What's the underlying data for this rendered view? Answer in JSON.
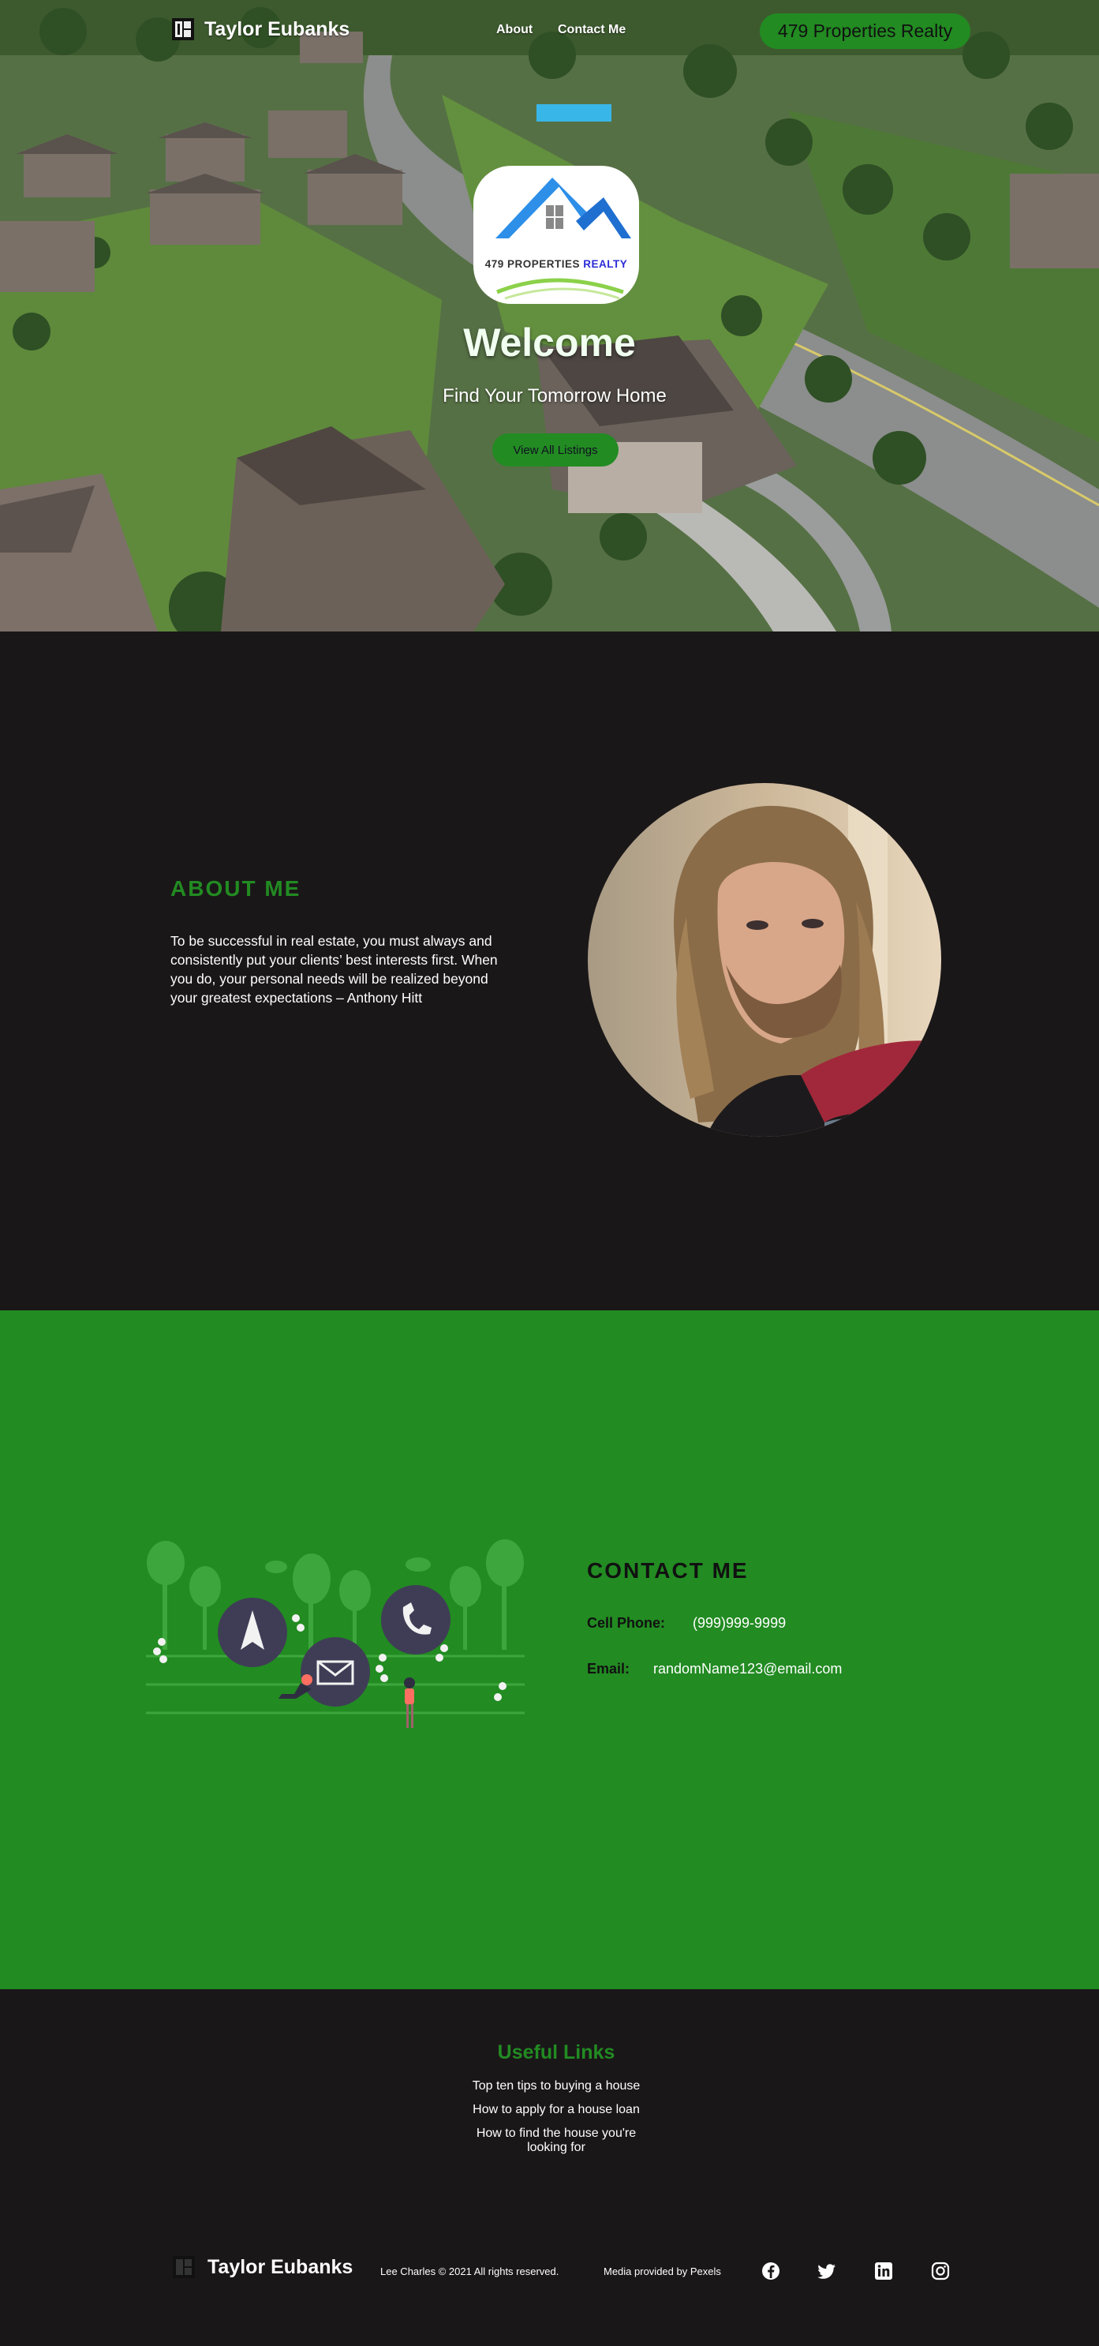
{
  "nav": {
    "brand": "Taylor Eubanks",
    "links": [
      "About",
      "Contact Me"
    ],
    "cta": "479 Properties Realty"
  },
  "hero": {
    "logo_text": "479 PROPERTIES",
    "logo_text_accent": "REALTY",
    "title": "Welcome",
    "tagline": "Find Your Tomorrow Home",
    "button": "View All Listings"
  },
  "about": {
    "heading": "ABOUT ME",
    "text": "To be successful in real estate, you must always and consistently put your clients’ best interests first. When you do, your personal needs will be realized beyond your greatest expectations – Anthony Hitt"
  },
  "contact": {
    "heading": "CONTACT ME",
    "phone_label": "Cell Phone:",
    "phone_value": "(999)999-9999",
    "email_label": "Email:",
    "email_value": "randomName123@email.com"
  },
  "footer": {
    "links_heading": "Useful Links",
    "links": [
      "Top ten tips to buying a house",
      "How to apply for a house loan",
      "How to find the house you're",
      "looking for"
    ],
    "brand": "Taylor Eubanks",
    "copyright": "Lee Charles © 2021 All rights reserved.",
    "media_credit": "Media provided by Pexels",
    "social_icons": [
      "facebook-icon",
      "twitter-icon",
      "linkedin-icon",
      "instagram-icon"
    ]
  },
  "colors": {
    "accent_green": "#228b22",
    "dark_bg": "#1a1718"
  }
}
